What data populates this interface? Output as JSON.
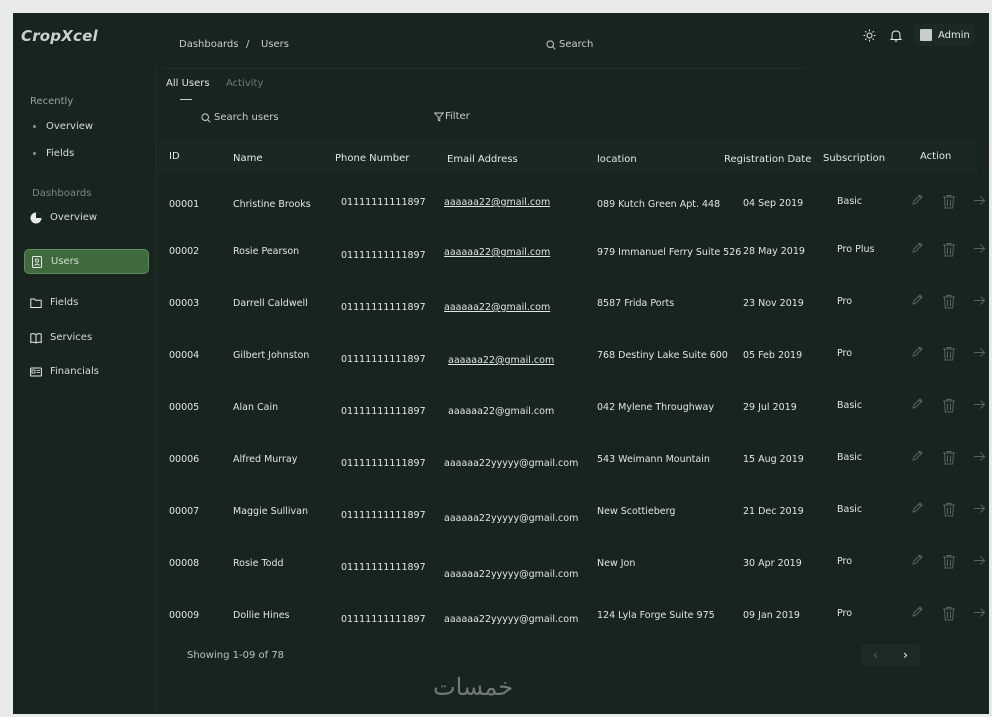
{
  "app": {
    "logo": "CropXcel"
  },
  "header": {
    "breadcrumb": [
      "Dashboards",
      "/",
      "Users"
    ],
    "search_label": "Search",
    "user_label": "Admin"
  },
  "sidebar": {
    "recently_title": "Recently",
    "recent_items": [
      "Overview",
      "Fields"
    ],
    "dashboards_title": "Dashboards",
    "overview_label": "Overview",
    "nav": [
      {
        "label": "Users",
        "icon": "user-card-icon",
        "active": true
      },
      {
        "label": "Fields",
        "icon": "folder-icon"
      },
      {
        "label": "Services",
        "icon": "book-icon"
      },
      {
        "label": "Financials",
        "icon": "id-card-icon"
      }
    ]
  },
  "tabs": [
    "All Users",
    "Activity"
  ],
  "toolbar": {
    "search_placeholder": "Search  users",
    "filter_label": "Filter"
  },
  "table": {
    "columns": [
      "ID",
      "Name",
      "Phone Number",
      "Email Address",
      "location",
      "Registration Date",
      "Subscription",
      "Action"
    ],
    "rows": [
      {
        "id": "00001",
        "name": "Christine Brooks",
        "phone": "01111111111897",
        "email": "aaaaaa22@gmail.com",
        "email_link": true,
        "location": "089 Kutch Green Apt. 448",
        "date": "04 Sep 2019",
        "sub": "Basic"
      },
      {
        "id": "00002",
        "name": "Rosie Pearson",
        "phone": "01111111111897",
        "email": "aaaaaa22@gmail.com",
        "email_link": true,
        "location": "979 Immanuel Ferry Suite 526",
        "date": "28 May 2019",
        "sub": "Pro Plus"
      },
      {
        "id": "00003",
        "name": "Darrell Caldwell",
        "phone": "01111111111897",
        "email": "aaaaaa22@gmail.com",
        "email_link": true,
        "location": "8587 Frida Ports",
        "date": "23 Nov 2019",
        "sub": "Pro"
      },
      {
        "id": "00004",
        "name": "Gilbert Johnston",
        "phone": "01111111111897",
        "email": "aaaaaa22@gmail.com",
        "email_link": true,
        "location": "768 Destiny Lake Suite 600",
        "date": "05 Feb 2019",
        "sub": "Pro"
      },
      {
        "id": "00005",
        "name": "Alan Cain",
        "phone": "01111111111897",
        "email": "aaaaaa22@gmail.com",
        "email_link": false,
        "location": "042 Mylene Throughway",
        "date": "29 Jul 2019",
        "sub": "Basic"
      },
      {
        "id": "00006",
        "name": "Alfred Murray",
        "phone": "01111111111897",
        "email": "aaaaaa22yyyyy@gmail.com",
        "email_link": false,
        "location": "543 Weimann Mountain",
        "date": "15 Aug 2019",
        "sub": "Basic"
      },
      {
        "id": "00007",
        "name": "Maggie Sullivan",
        "phone": "01111111111897",
        "email": "aaaaaa22yyyyy@gmail.com",
        "email_link": false,
        "location": "New Scottieberg",
        "date": "21 Dec 2019",
        "sub": "Basic"
      },
      {
        "id": "00008",
        "name": "Rosie Todd",
        "phone": "01111111111897",
        "email": "aaaaaa22yyyyy@gmail.com",
        "email_link": false,
        "location": "New Jon",
        "date": "30 Apr 2019",
        "sub": "Pro"
      },
      {
        "id": "00009",
        "name": "Dollie Hines",
        "phone": "01111111111897",
        "email": "aaaaaa22yyyyy@gmail.com",
        "email_link": false,
        "location": "124 Lyla Forge Suite 975",
        "date": "09 Jan 2019",
        "sub": "Pro"
      }
    ]
  },
  "pagination": {
    "showing": "Showing 1-09 of 78",
    "prev": "‹",
    "next": "›"
  },
  "watermark": "خمسات"
}
